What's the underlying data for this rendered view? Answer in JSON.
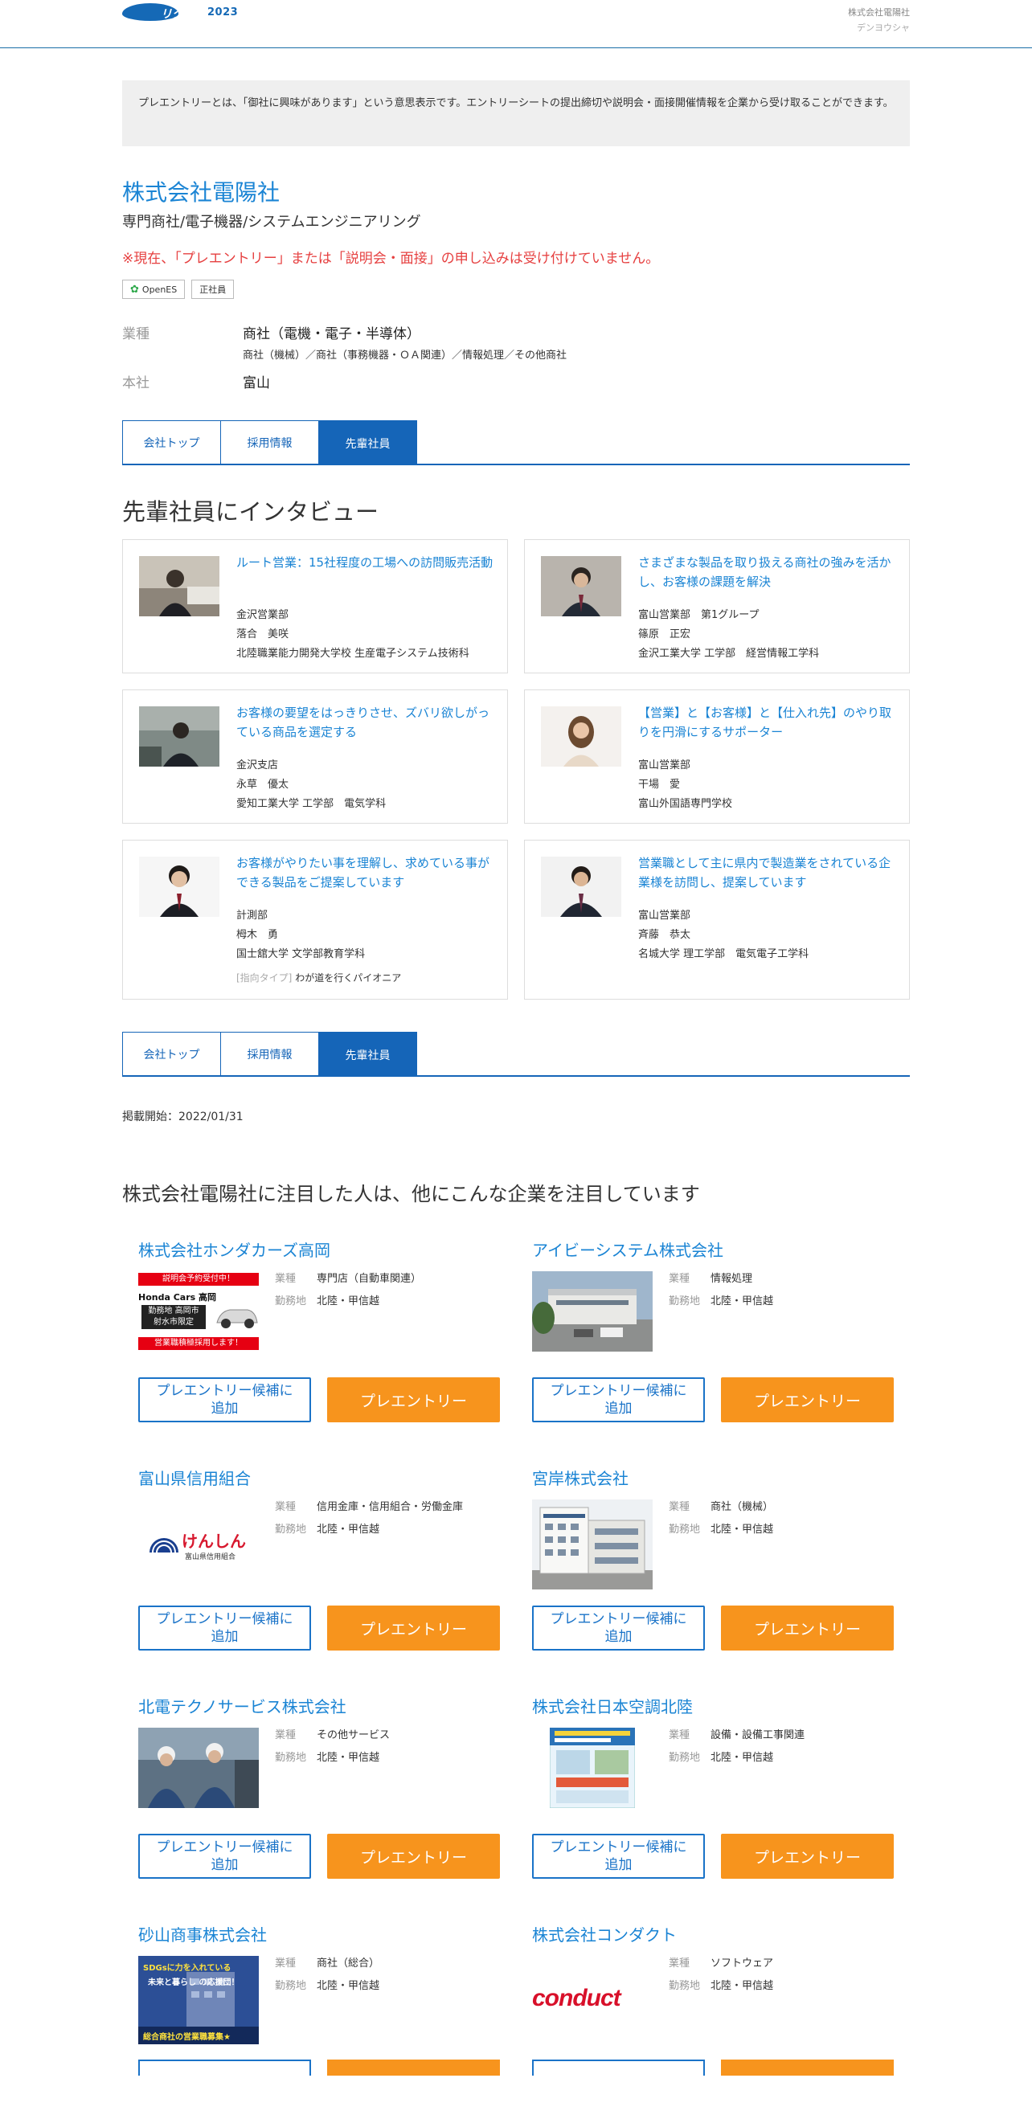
{
  "header": {
    "logo_text": "リクナビ",
    "logo_year": "2023",
    "company": "株式会社電陽社",
    "company_kana": "デンヨウシャ"
  },
  "notice": "プレエントリーとは、「御社に興味があります」という意思表示です。エントリーシートの提出締切や説明会・面接開催情報を企業から受け取ることができます。",
  "company": {
    "name": "株式会社電陽社",
    "subtitle": "専門商社/電子機器/システムエンジニアリング",
    "warning": "※現在、「プレエントリー」または「説明会・面接」の申し込みは受け付けていません。",
    "tags": [
      "OpenES",
      "正社員"
    ],
    "industry_label": "業種",
    "industry": "商社（電機・電子・半導体）",
    "industry_sub": "商社（機械）／商社（事務機器・ＯＡ関連）／情報処理／その他商社",
    "hq_label": "本社",
    "hq": "富山"
  },
  "tabs": [
    "会社トップ",
    "採用情報",
    "先輩社員"
  ],
  "interview_title": "先輩社員にインタビュー",
  "interviews": [
    {
      "title": "ルート営業：15社程度の工場への訪問販売活動",
      "dept": "金沢営業部",
      "name": "落合　美咲",
      "school": "北陸職業能力開発大学校 生産電子システム技術科"
    },
    {
      "title": "さまざまな製品を取り扱える商社の強みを活かし、お客様の課題を解決",
      "dept": "富山営業部　第1グループ",
      "name": "篠原　正宏",
      "school": "金沢工業大学 工学部　経営情報工学科"
    },
    {
      "title": "お客様の要望をはっきりさせ、ズバリ欲しがっている商品を選定する",
      "dept": "金沢支店",
      "name": "永草　優太",
      "school": "愛知工業大学 工学部　電気学科"
    },
    {
      "title": "【営業】と【お客様】と【仕入れ先】のやり取りを円滑にするサポーター",
      "dept": "富山営業部",
      "name": "干場　愛",
      "school": "富山外国語専門学校"
    },
    {
      "title": "お客様がやりたい事を理解し、求めている事ができる製品をご提案しています",
      "dept": "計測部",
      "name": "栂木　勇",
      "school": "国士舘大学 文学部教育学科",
      "type_label": "[指向タイプ]",
      "type": "わが道を行くパイオニア"
    },
    {
      "title": "営業職として主に県内で製造業をされている企業様を訪問し、提案しています",
      "dept": "富山営業部",
      "name": "斉藤　恭太",
      "school": "名城大学 理工学部　電気電子工学科"
    }
  ],
  "post_date": "掲載開始：2022/01/31",
  "rec_title": "株式会社電陽社に注目した人は、他にこんな企業を注目しています",
  "rec_labels": {
    "industry": "業種",
    "location": "勤務地",
    "candidate": "プレエントリー候補に追加",
    "entry": "プレエントリー"
  },
  "recommendations": [
    {
      "name": "株式会社ホンダカーズ高岡",
      "industry": "専門店（自動車関連）",
      "location": "北陸・甲信越",
      "img_lines": [
        "説明会予約受付中！",
        "Honda Cars 高岡",
        "勤務地 高岡市",
        "射水市限定",
        "営業職積極採用します！"
      ]
    },
    {
      "name": "アイビーシステム株式会社",
      "industry": "情報処理",
      "location": "北陸・甲信越"
    },
    {
      "name": "富山県信用組合",
      "industry": "信用金庫・信用組合・労働金庫",
      "location": "北陸・甲信越",
      "img_lines": [
        "けんしん",
        "富山県信用組合"
      ]
    },
    {
      "name": "宮岸株式会社",
      "industry": "商社（機械）",
      "location": "北陸・甲信越"
    },
    {
      "name": "北電テクノサービス株式会社",
      "industry": "その他サービス",
      "location": "北陸・甲信越"
    },
    {
      "name": "株式会社日本空調北陸",
      "industry": "設備・設備工事関連",
      "location": "北陸・甲信越"
    },
    {
      "name": "砂山商事株式会社",
      "industry": "商社（総合）",
      "location": "北陸・甲信越",
      "img_lines": [
        "SDGsに力を入れている",
        "未来と暮らし の応援団！",
        "総合商社の営業職募集★"
      ]
    },
    {
      "name": "株式会社コンダクト",
      "industry": "ソフトウェア",
      "location": "北陸・甲信越",
      "img_lines": [
        "conduct"
      ]
    }
  ]
}
